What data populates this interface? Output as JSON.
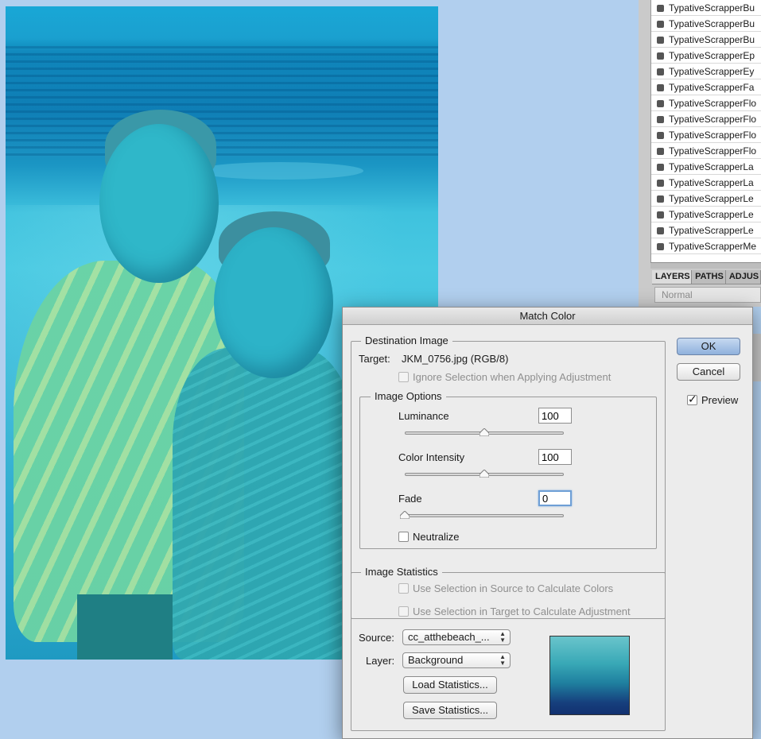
{
  "layers_list": {
    "items": [
      "TypativeScrapperBu",
      "TypativeScrapperBu",
      "TypativeScrapperBu",
      "TypativeScrapperEp",
      "TypativeScrapperEy",
      "TypativeScrapperFa",
      "TypativeScrapperFlo",
      "TypativeScrapperFlo",
      "TypativeScrapperFlo",
      "TypativeScrapperFlo",
      "TypativeScrapperLa",
      "TypativeScrapperLa",
      "TypativeScrapperLe",
      "TypativeScrapperLe",
      "TypativeScrapperLe",
      "TypativeScrapperMe"
    ]
  },
  "layers_panel": {
    "tabs": [
      "LAYERS",
      "PATHS",
      "ADJUS"
    ],
    "blend_mode": "Normal"
  },
  "dialog": {
    "title": "Match Color",
    "destination": {
      "legend": "Destination Image",
      "target_label": "Target:",
      "target_value": "JKM_0756.jpg (RGB/8)",
      "ignore_selection_label": "Ignore Selection when Applying Adjustment"
    },
    "image_options": {
      "legend": "Image Options",
      "luminance_label": "Luminance",
      "luminance_value": "100",
      "luminance_level": 0.5,
      "color_intensity_label": "Color Intensity",
      "color_intensity_value": "100",
      "color_intensity_level": 0.5,
      "fade_label": "Fade",
      "fade_value": "0",
      "fade_level": 0.0,
      "neutralize_label": "Neutralize"
    },
    "image_statistics": {
      "legend": "Image Statistics",
      "use_source_label": "Use Selection in Source to Calculate Colors",
      "use_target_label": "Use Selection in Target to Calculate Adjustment",
      "source_label": "Source:",
      "source_value": "cc_atthebeach_...",
      "layer_label": "Layer:",
      "layer_value": "Background",
      "load_label": "Load Statistics...",
      "save_label": "Save Statistics..."
    },
    "ok_label": "OK",
    "cancel_label": "Cancel",
    "preview_label": "Preview",
    "preview_checked": true
  }
}
